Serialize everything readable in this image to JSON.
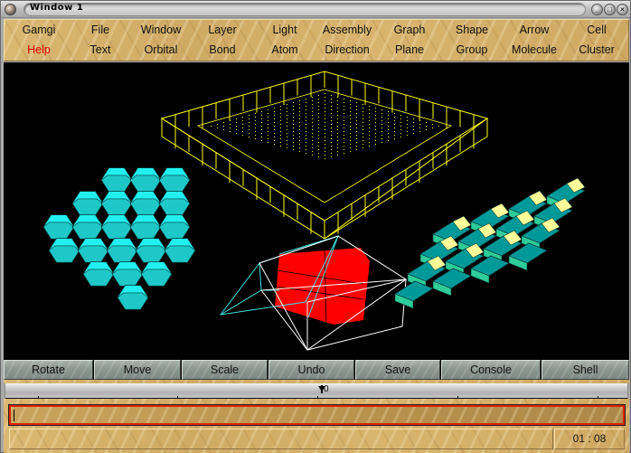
{
  "window": {
    "title": "Window 1",
    "controls": {
      "minimize": "_",
      "maximize": "□",
      "close": "×"
    }
  },
  "menu": {
    "row1": [
      "Gamgi",
      "File",
      "Window",
      "Layer",
      "Light",
      "Assembly",
      "Graph",
      "Shape",
      "Arrow",
      "Cell"
    ],
    "row2": [
      "Help",
      "Text",
      "Orbital",
      "Bond",
      "Atom",
      "Direction",
      "Plane",
      "Group",
      "Molecule",
      "Cluster"
    ],
    "highlight": "Help",
    "highlight_color": "#e00000"
  },
  "viewport": {
    "background": "#000000",
    "objects": [
      {
        "name": "yellow-wireframe-lattice",
        "color": "#ffff00"
      },
      {
        "name": "cyan-truncated-octahedra-cluster",
        "color": "#1de6e6"
      },
      {
        "name": "red-cube-with-wireframe-cells",
        "color": "#ff0000",
        "wire_colors": [
          "#40e0e0",
          "#ffffff"
        ]
      },
      {
        "name": "teal-rhombic-tiling",
        "color": "#009a9a",
        "accent": "#ffff99"
      }
    ]
  },
  "toolbar": {
    "buttons": [
      "Rotate",
      "Move",
      "Scale",
      "Undo",
      "Save",
      "Console",
      "Shell"
    ]
  },
  "timeline": {
    "marker_label": "0"
  },
  "command": {
    "value": ""
  },
  "status": {
    "message": "",
    "clock": "01 : 08"
  }
}
